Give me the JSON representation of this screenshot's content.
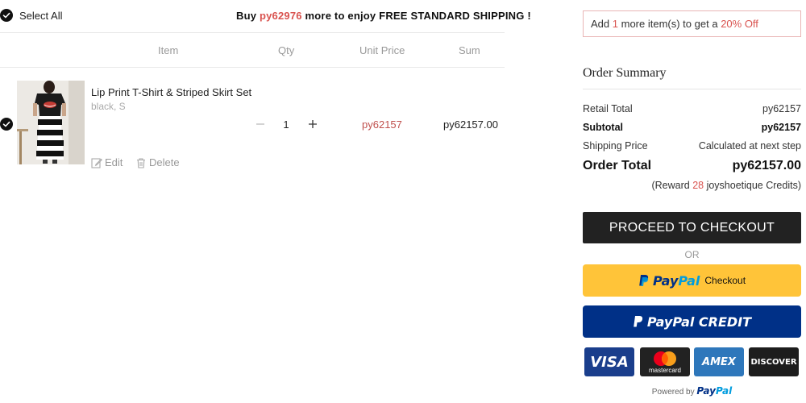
{
  "cart": {
    "select_all_label": "Select All",
    "shipping_banner": {
      "prefix": "Buy ",
      "amount": "py62976",
      "suffix": " more to enjoy FREE STANDARD SHIPPING !"
    },
    "columns": {
      "item": "Item",
      "qty": "Qty",
      "unit_price": "Unit Price",
      "sum": "Sum"
    },
    "items": [
      {
        "title": "Lip Print T-Shirt & Striped Skirt Set",
        "variant": "black, S",
        "quantity": "1",
        "unit_price": "py62157",
        "sum": "py62157.00",
        "checked": true,
        "edit_label": "Edit",
        "delete_label": "Delete"
      }
    ]
  },
  "summary": {
    "promo": {
      "prefix": "Add ",
      "count": "1",
      "middle": " more item(s) to get a ",
      "discount": "20% Off"
    },
    "title": "Order Summary",
    "retail_total_label": "Retail Total",
    "retail_total_value": "py62157",
    "subtotal_label": "Subtotal",
    "subtotal_value": "py62157",
    "shipping_label": "Shipping Price",
    "shipping_value": "Calculated at next step",
    "order_total_label": "Order Total",
    "order_total_value": "py62157.00",
    "reward": {
      "prefix": "(Reward ",
      "points": "28",
      "suffix": " joyshoetique Credits)"
    },
    "checkout_label": "PROCEED TO CHECKOUT",
    "or_label": "OR",
    "paypal": {
      "word_part1": "Pay",
      "word_part2": "Pal",
      "checkout_label": "Checkout"
    },
    "paypal_credit": {
      "word": "PayPal",
      "credit_label": "CREDIT"
    },
    "cards": {
      "visa": "VISA",
      "mastercard": "mastercard",
      "amex": "AMEX",
      "discover": "DISCOVER"
    },
    "powered_by": {
      "prefix": "Powered by ",
      "brand_part1": "Pay",
      "brand_part2": "Pal"
    }
  },
  "colors": {
    "accent_red": "#d9534f",
    "paypal_yellow": "#ffc439",
    "paypal_navy": "#003087",
    "paypal_blue": "#009cde",
    "checkout_black": "#222222"
  }
}
